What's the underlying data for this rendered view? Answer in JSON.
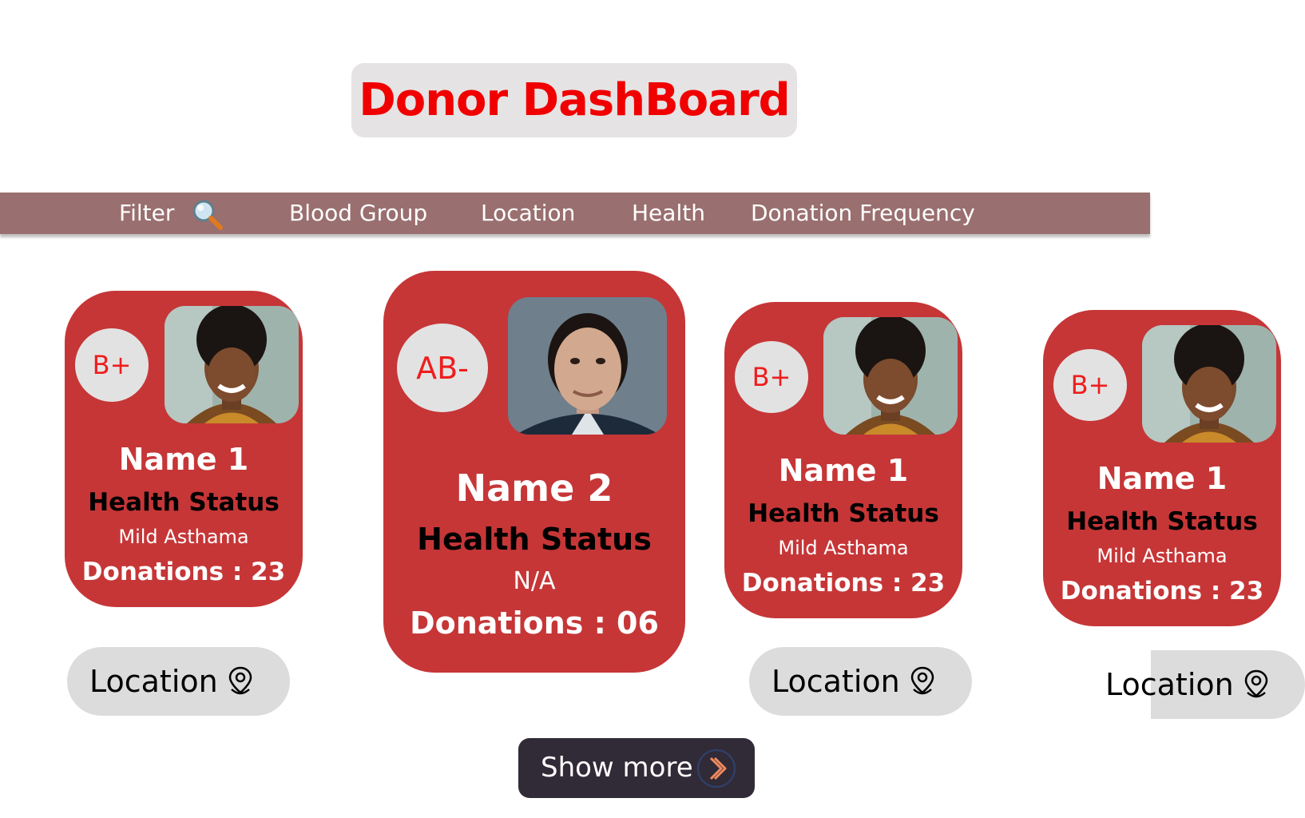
{
  "header": {
    "title": "Donor DashBoard"
  },
  "filter_bar": {
    "filter_label": "Filter",
    "filter_icon": "magnifier-icon",
    "items": [
      "Blood Group",
      "Location",
      "Health",
      "Donation Frequency"
    ]
  },
  "cards": [
    {
      "blood_group": "B+",
      "name": "Name 1",
      "health_label": "Health Status",
      "condition": "Mild Asthama",
      "donations": "Donations : 23",
      "location_label": "Location"
    },
    {
      "blood_group": "AB-",
      "name": "Name 2",
      "health_label": "Health Status",
      "condition": "N/A",
      "donations": "Donations : 06"
    },
    {
      "blood_group": "B+",
      "name": "Name 1",
      "health_label": "Health Status",
      "condition": "Mild Asthama",
      "donations": "Donations : 23",
      "location_label": "Location"
    },
    {
      "blood_group": "B+",
      "name": "Name 1",
      "health_label": "Health Status",
      "condition": "Mild Asthama",
      "donations": "Donations : 23",
      "location_label": "Location"
    }
  ],
  "show_more": {
    "label": "Show more",
    "icon": "chevron-right-icon"
  },
  "colors": {
    "title_red": "#f00000",
    "card_red": "#c63637",
    "filter_bar": "#9a6f6f",
    "badge_bg": "#e3e2e2",
    "button_grey": "#dddcdc",
    "show_more_bg": "#312a37",
    "accent_orange": "#f08a5d"
  }
}
